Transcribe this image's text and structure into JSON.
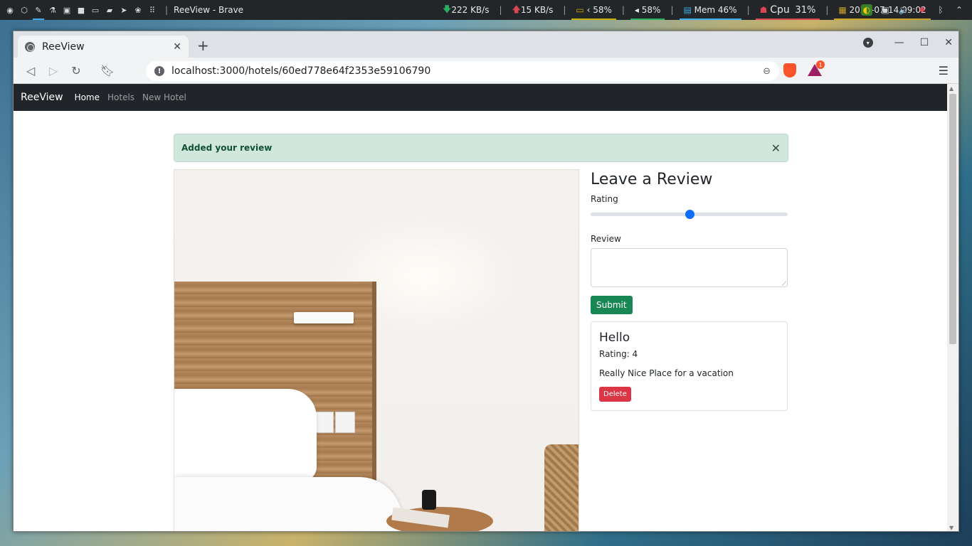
{
  "panel": {
    "window_title": "ReeView - Brave",
    "launcher_icons": [
      "brave-icon",
      "apps-icon",
      "brush-icon",
      "flask-icon",
      "image-icon",
      "video-icon",
      "laptop-icon",
      "folder-icon",
      "telegram-icon",
      "paw-icon",
      "grid-icon"
    ],
    "separator": "|",
    "download": "222 KB/s",
    "upload": "15 KB/s",
    "battery": "58%",
    "volume": "58%",
    "memory": "Mem 46%",
    "cpu_label": "Cpu",
    "cpu_value": "31%",
    "datetime": "2021-07-14 09:02",
    "colors": {
      "battery": "#c9b000",
      "volume": "#27ae60",
      "memory": "#3daee9",
      "cpu": "#da4453",
      "datetime": "#c9a227"
    }
  },
  "browser": {
    "tab_title": "ReeView",
    "url": "localhost:3000/hotels/60ed778e64f2353e59106790",
    "badge_count": "1"
  },
  "navbar": {
    "brand": "ReeView",
    "links": [
      {
        "label": "Home",
        "active": true
      },
      {
        "label": "Hotels",
        "active": false
      },
      {
        "label": "New Hotel",
        "active": false
      }
    ]
  },
  "alert": {
    "message": "Added your review"
  },
  "review_form": {
    "title": "Leave a Review",
    "rating_label": "Rating",
    "rating_value": 3,
    "rating_min": 1,
    "rating_max": 5,
    "review_label": "Review",
    "review_value": "",
    "submit_label": "Submit"
  },
  "reviews": [
    {
      "title": "Hello",
      "rating_text": "Rating: 4",
      "body": "Really Nice Place for a vacation",
      "delete_label": "Delete"
    }
  ]
}
